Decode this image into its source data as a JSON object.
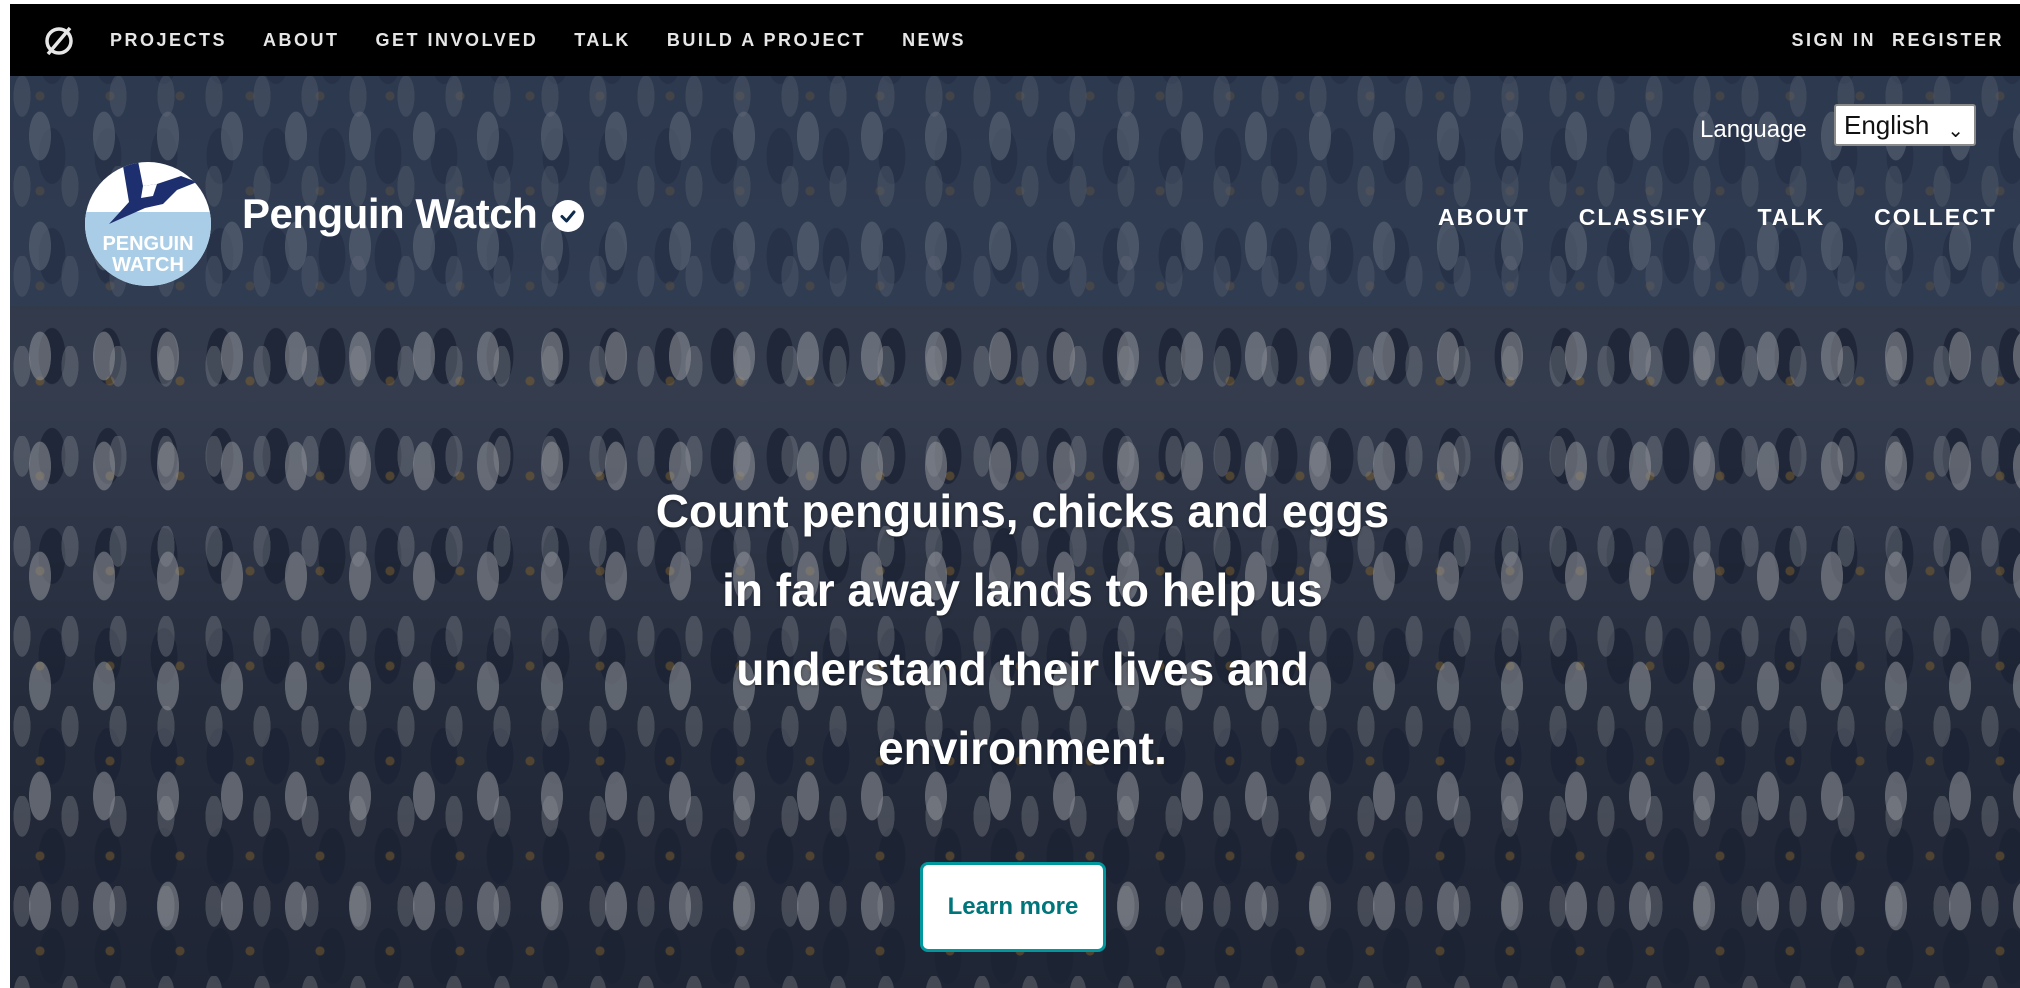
{
  "topbar": {
    "nav": [
      "PROJECTS",
      "ABOUT",
      "GET INVOLVED",
      "TALK",
      "BUILD A PROJECT",
      "NEWS"
    ],
    "sign_in": "SIGN IN",
    "register": "REGISTER"
  },
  "project": {
    "title": "Penguin Watch",
    "logo_text_line1": "PENGUIN",
    "logo_text_line2": "WATCH",
    "nav": [
      "ABOUT",
      "CLASSIFY",
      "TALK",
      "COLLECT"
    ]
  },
  "language": {
    "label": "Language",
    "selected": "English"
  },
  "hero": {
    "tagline_lines": [
      "Count penguins, chicks and eggs",
      "in far away lands to help us",
      "understand their lives and",
      "environment."
    ],
    "button": "Learn more"
  },
  "colors": {
    "accent": "#00979d",
    "topbar": "#000000"
  }
}
